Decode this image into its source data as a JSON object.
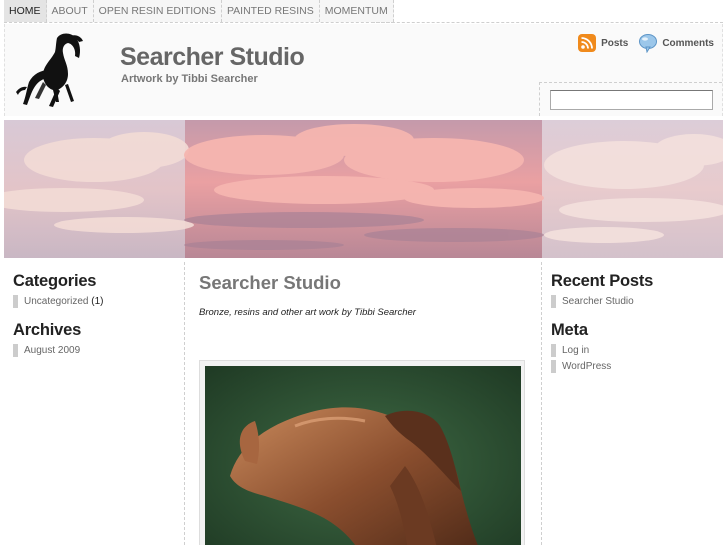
{
  "nav": {
    "items": [
      {
        "label": "HOME",
        "active": true
      },
      {
        "label": "ABOUT",
        "active": false
      },
      {
        "label": "OPEN RESIN EDITIONS",
        "active": false
      },
      {
        "label": "PAINTED RESINS",
        "active": false
      },
      {
        "label": "MOMENTUM",
        "active": false
      }
    ]
  },
  "header": {
    "title": "Searcher Studio",
    "description": "Artwork by Tibbi Searcher",
    "feeds": {
      "posts_label": "Posts",
      "comments_label": "Comments",
      "posts_icon": "rss-icon",
      "comments_icon": "speech-bubble-icon"
    },
    "search": {
      "value": "",
      "placeholder": ""
    }
  },
  "sidebar_left": {
    "categories_title": "Categories",
    "categories": [
      {
        "label": "Uncategorized",
        "count": "(1)"
      }
    ],
    "archives_title": "Archives",
    "archives": [
      {
        "label": "August 2009"
      }
    ]
  },
  "main": {
    "post_title": "Searcher Studio",
    "post_excerpt": "Bronze, resins and other art work by Tibbi Searcher"
  },
  "sidebar_right": {
    "recent_title": "Recent Posts",
    "recent_posts": [
      {
        "label": "Searcher Studio"
      }
    ],
    "meta_title": "Meta",
    "meta_links": [
      {
        "label": "Log in"
      },
      {
        "label": "WordPress"
      }
    ]
  },
  "colors": {
    "rss_orange": "#f08a1c",
    "banner_pink": "#e8a3a8",
    "image_green": "#2f4f34"
  }
}
